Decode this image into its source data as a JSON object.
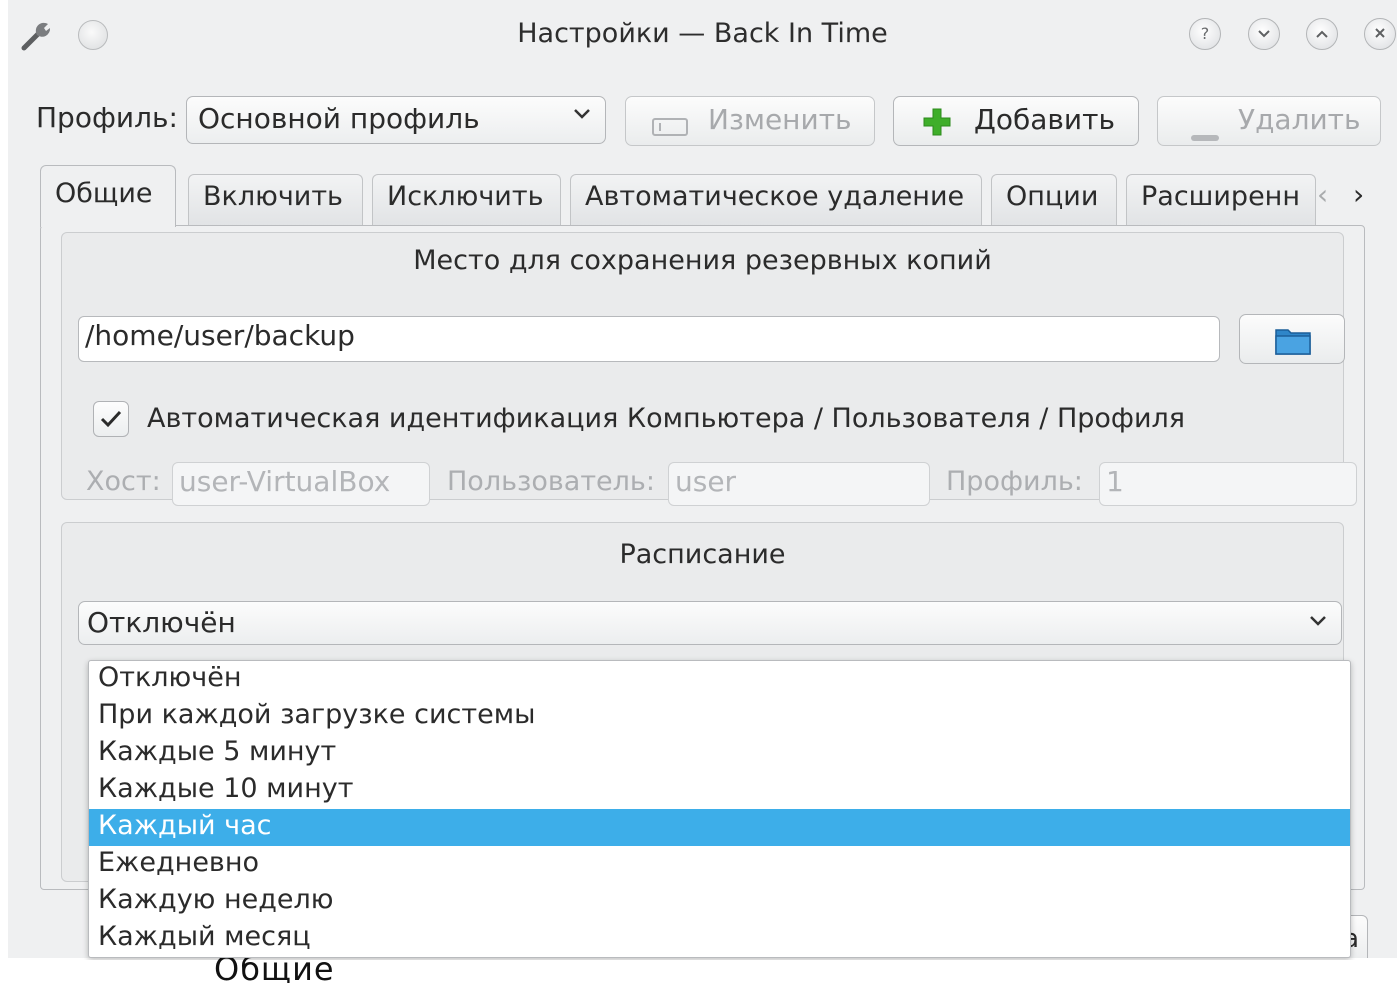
{
  "window": {
    "title": "Настройки — Back In Time"
  },
  "profile": {
    "label": "Профиль:",
    "selected": "Основной профиль",
    "edit_label": "Изменить",
    "add_label": "Добавить",
    "remove_label": "Удалить"
  },
  "tabs": [
    {
      "label": "Общие"
    },
    {
      "label": "Включить"
    },
    {
      "label": "Исключить"
    },
    {
      "label": "Автоматическое удаление"
    },
    {
      "label": "Опции"
    },
    {
      "label": "Расширенн"
    }
  ],
  "backup_location": {
    "title": "Место для сохранения резервных копий",
    "path": "/home/user/backup",
    "auto_id_label": "Автоматическая идентификация Компьютера / Пользователя / Профиля",
    "auto_id_checked": true,
    "host_label": "Хост:",
    "host_value": "user-VirtualBox",
    "user_label": "Пользователь:",
    "user_value": "user",
    "profile_label": "Профиль:",
    "profile_value": "1"
  },
  "schedule": {
    "title": "Расписание",
    "selected": "Отключён",
    "options": [
      "Отключён",
      "При каждой загрузке системы",
      "Каждые 5 минут",
      "Каждые 10 минут",
      "Каждый час",
      "Ежедневно",
      "Каждую неделю",
      "Каждый месяц"
    ],
    "highlighted_index": 4
  },
  "partial": {
    "hidden_button_fragment": "а",
    "caption_fragment": "Общие"
  },
  "colors": {
    "window_bg": "#eff0f1",
    "highlight": "#3daee9",
    "add_icon": "#3fae2a"
  }
}
